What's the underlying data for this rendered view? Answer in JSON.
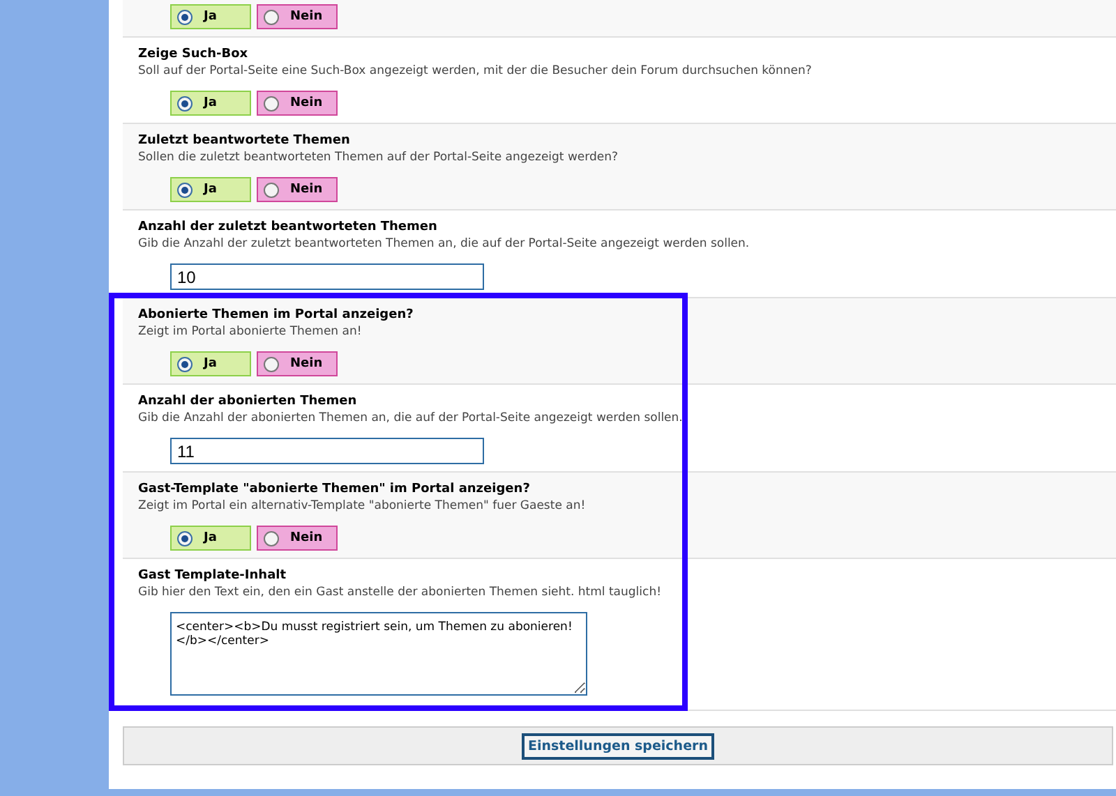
{
  "settings": [
    {
      "kind": "radio",
      "options": [
        {
          "label": "Ja",
          "selected": true
        },
        {
          "label": "Nein",
          "selected": false
        }
      ]
    },
    {
      "kind": "radio",
      "title": "Zeige Such-Box",
      "description": "Soll auf der Portal-Seite eine Such-Box angezeigt werden, mit der die Besucher dein Forum durchsuchen können?",
      "options": [
        {
          "label": "Ja",
          "selected": true
        },
        {
          "label": "Nein",
          "selected": false
        }
      ]
    },
    {
      "kind": "radio",
      "title": "Zuletzt beantwortete Themen",
      "description": "Sollen die zuletzt beantworteten Themen auf der Portal-Seite angezeigt werden?",
      "options": [
        {
          "label": "Ja",
          "selected": true
        },
        {
          "label": "Nein",
          "selected": false
        }
      ]
    },
    {
      "kind": "input",
      "title": "Anzahl der zuletzt beantworteten Themen",
      "description": "Gib die Anzahl der zuletzt beantworteten Themen an, die auf der Portal-Seite angezeigt werden sollen.",
      "value": "10"
    }
  ],
  "highlighted_group": {
    "settings": [
      {
        "kind": "radio",
        "title": "Abonierte Themen im Portal anzeigen?",
        "description": "Zeigt im Portal abonierte Themen an!",
        "options": [
          {
            "label": "Ja",
            "selected": true
          },
          {
            "label": "Nein",
            "selected": false
          }
        ]
      },
      {
        "kind": "input",
        "title": "Anzahl der abonierten Themen",
        "description": "Gib die Anzahl der abonierten Themen an, die auf der Portal-Seite angezeigt werden sollen.",
        "value": "11"
      },
      {
        "kind": "radio",
        "title": "Gast-Template \"abonierte Themen\" im Portal anzeigen?",
        "description": "Zeigt im Portal ein alternativ-Template \"abonierte Themen\" fuer Gaeste an!",
        "options": [
          {
            "label": "Ja",
            "selected": true
          },
          {
            "label": "Nein",
            "selected": false
          }
        ]
      },
      {
        "kind": "textarea",
        "title": "Gast Template-Inhalt",
        "description": "Gib hier den Text ein, den ein Gast anstelle der abonierten Themen sieht. html tauglich!",
        "value": "<center><b>Du musst registriert sein, um Themen zu abonieren!</b></center>"
      }
    ]
  },
  "save_button": "Einstellungen speichern"
}
